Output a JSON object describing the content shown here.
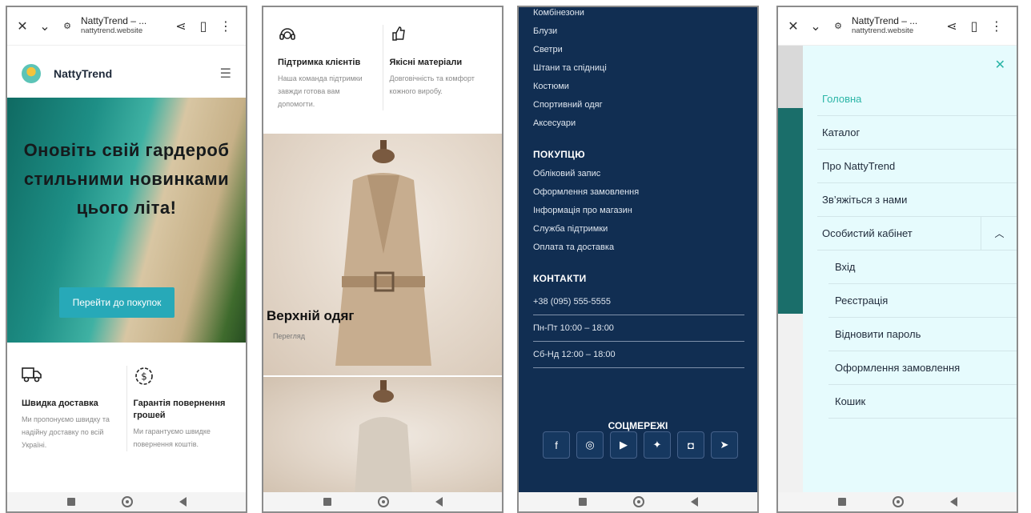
{
  "browser": {
    "title": "NattyTrend – ...",
    "url": "nattytrend.website"
  },
  "site": {
    "brand": "NattyTrend",
    "hero_title": "Оновіть свій гардероб стильними новинками цього літа!",
    "hero_button": "Перейти до покупок"
  },
  "features": {
    "delivery_title": "Швидка доставка",
    "delivery_text": "Ми пропонуємо швидку та надійну доставку по всій Україні.",
    "refund_title": "Гарантія повернення грошей",
    "refund_text": "Ми гарантуємо швидке повернення коштів.",
    "support_title": "Підтримка клієнтів",
    "support_text": "Наша команда підтримки завжди готова вам допомогти.",
    "quality_title": "Якісні матеріали",
    "quality_text": "Довговічність та комфорт кожного виробу."
  },
  "category": {
    "title": "Верхній одяг",
    "link": "Перегляд"
  },
  "footer": {
    "catalog_items": [
      "Комбінезони",
      "Блузи",
      "Светри",
      "Штани та спідниці",
      "Костюми",
      "Спортивний одяг",
      "Аксесуари"
    ],
    "purchase_heading": "ПОКУПЦЮ",
    "purchase_items": [
      "Обліковий запис",
      "Оформлення замовлення",
      "Інформація про магазин",
      "Служба підтримки",
      "Оплата та доставка"
    ],
    "contacts_heading": "КОНТАКТИ",
    "contacts": [
      "+38 (095) 555-5555",
      "Пн-Пт 10:00 – 18:00",
      "Сб-Нд 12:00 – 18:00"
    ],
    "social_heading": "СОЦМЕРЕЖІ",
    "social_icons": [
      "facebook-icon",
      "instagram-icon",
      "youtube-icon",
      "twitter-icon",
      "discord-icon",
      "telegram-icon"
    ]
  },
  "menu": {
    "items": [
      "Головна",
      "Каталог",
      "Про NattyTrend",
      "Зв’яжіться з нами",
      "Особистий кабінет"
    ],
    "sub_items": [
      "Вхід",
      "Реєстрація",
      "Відновити пароль",
      "Оформлення замовлення",
      "Кошик"
    ]
  },
  "colors": {
    "accent": "#27a9b8",
    "footer_bg": "#112e52",
    "menu_bg": "#e6fbfd"
  }
}
